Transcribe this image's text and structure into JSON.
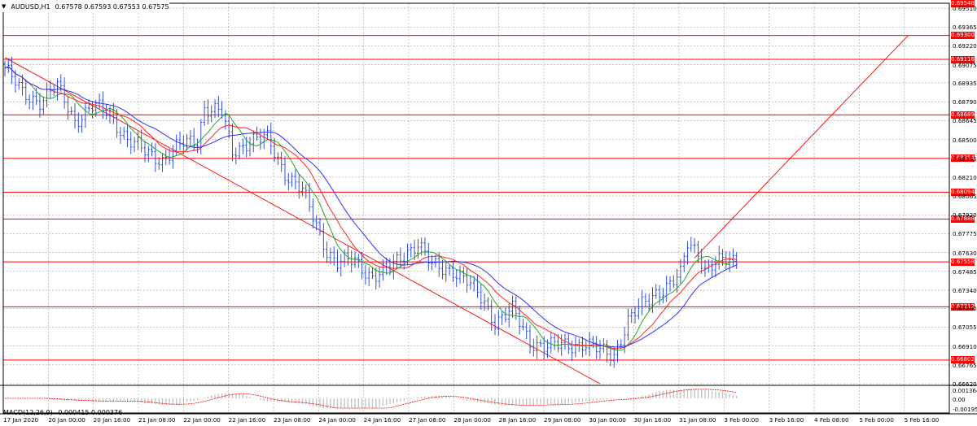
{
  "window": {
    "symbol": "AUDUSD,H1",
    "ohlc": "0.67578 0.67593 0.67553 0.67575",
    "indicator_label": "MACD(12,26,9)",
    "indicator_values": "0.000415 0.000376"
  },
  "colors": {
    "background": "#ffffff",
    "grid": "#a0a0a0",
    "candles": "#1f3fcc",
    "levels": "#ff0000",
    "ma_fast": "#22aa22",
    "ma_mid": "#ff2222",
    "ma_slow": "#3030ff",
    "macd_hist": "#c0c0c0",
    "macd_signal": "#ff0000"
  },
  "chart_data": {
    "type": "candlestick",
    "price_axis": {
      "min": 0.6662,
      "max": 0.69548,
      "tick_labels": [
        "0.69510",
        "0.69365",
        "0.69220",
        "0.69075",
        "0.68935",
        "0.68790",
        "0.68645",
        "0.68500",
        "0.68355",
        "0.68210",
        "0.68065",
        "0.67920",
        "0.67775",
        "0.67630",
        "0.67485",
        "0.67340",
        "0.67200",
        "0.67055",
        "0.66910",
        "0.66765",
        "0.66620"
      ]
    },
    "time_axis": {
      "labels": [
        "17 Jan 2020",
        "20 Jan 00:00",
        "20 Jan 16:00",
        "21 Jan 08:00",
        "22 Jan 00:00",
        "22 Jan 16:00",
        "23 Jan 08:00",
        "24 Jan 00:00",
        "24 Jan 16:00",
        "27 Jan 08:00",
        "28 Jan 00:00",
        "28 Jan 16:00",
        "29 Jan 08:00",
        "30 Jan 00:00",
        "30 Jan 16:00",
        "31 Jan 08:00",
        "3 Feb 00:00",
        "3 Feb 16:00",
        "4 Feb 08:00",
        "5 Feb 00:00",
        "5 Feb 16:00"
      ],
      "bar_count": 210
    },
    "horizontal_levels": [
      "0.69548",
      "0.69300",
      "0.69116",
      "0.68689",
      "0.68354",
      "0.68094",
      "0.67888",
      "0.67558",
      "0.67212",
      "0.66802"
    ],
    "trendlines": [
      {
        "from": {
          "bar": 0,
          "price": 0.6913
        },
        "to": {
          "bar": 170,
          "price": 0.6662
        }
      },
      {
        "from": {
          "bar": 197,
          "price": 0.67588
        },
        "to": {
          "bar": 258,
          "price": 0.693
        }
      }
    ],
    "close_anchors": [
      {
        "bar": 0,
        "price": 0.6905
      },
      {
        "bar": 5,
        "price": 0.6885
      },
      {
        "bar": 10,
        "price": 0.688
      },
      {
        "bar": 15,
        "price": 0.689
      },
      {
        "bar": 20,
        "price": 0.6865
      },
      {
        "bar": 25,
        "price": 0.6875
      },
      {
        "bar": 30,
        "price": 0.687
      },
      {
        "bar": 35,
        "price": 0.685
      },
      {
        "bar": 40,
        "price": 0.684
      },
      {
        "bar": 45,
        "price": 0.6835
      },
      {
        "bar": 50,
        "price": 0.6845
      },
      {
        "bar": 55,
        "price": 0.685
      },
      {
        "bar": 57,
        "price": 0.6875
      },
      {
        "bar": 62,
        "price": 0.687
      },
      {
        "bar": 65,
        "price": 0.684
      },
      {
        "bar": 70,
        "price": 0.685
      },
      {
        "bar": 75,
        "price": 0.685
      },
      {
        "bar": 80,
        "price": 0.6825
      },
      {
        "bar": 85,
        "price": 0.681
      },
      {
        "bar": 88,
        "price": 0.679
      },
      {
        "bar": 92,
        "price": 0.6765
      },
      {
        "bar": 95,
        "price": 0.6755
      },
      {
        "bar": 100,
        "price": 0.6756
      },
      {
        "bar": 105,
        "price": 0.6745
      },
      {
        "bar": 110,
        "price": 0.675
      },
      {
        "bar": 115,
        "price": 0.6765
      },
      {
        "bar": 118,
        "price": 0.677
      },
      {
        "bar": 122,
        "price": 0.6752
      },
      {
        "bar": 128,
        "price": 0.675
      },
      {
        "bar": 132,
        "price": 0.674
      },
      {
        "bar": 137,
        "price": 0.6725
      },
      {
        "bar": 140,
        "price": 0.671
      },
      {
        "bar": 145,
        "price": 0.6718
      },
      {
        "bar": 150,
        "price": 0.6695
      },
      {
        "bar": 155,
        "price": 0.669
      },
      {
        "bar": 160,
        "price": 0.6692
      },
      {
        "bar": 165,
        "price": 0.6693
      },
      {
        "bar": 170,
        "price": 0.6687
      },
      {
        "bar": 174,
        "price": 0.6685
      },
      {
        "bar": 178,
        "price": 0.671
      },
      {
        "bar": 182,
        "price": 0.6722
      },
      {
        "bar": 186,
        "price": 0.6733
      },
      {
        "bar": 190,
        "price": 0.6738
      },
      {
        "bar": 193,
        "price": 0.6745
      },
      {
        "bar": 195,
        "price": 0.677
      },
      {
        "bar": 198,
        "price": 0.6765
      },
      {
        "bar": 200,
        "price": 0.675
      },
      {
        "bar": 204,
        "price": 0.6755
      },
      {
        "bar": 209,
        "price": 0.67575
      }
    ],
    "macd_axis": {
      "labels": [
        "0.001364",
        "0.00",
        "-0.001952"
      ]
    }
  }
}
